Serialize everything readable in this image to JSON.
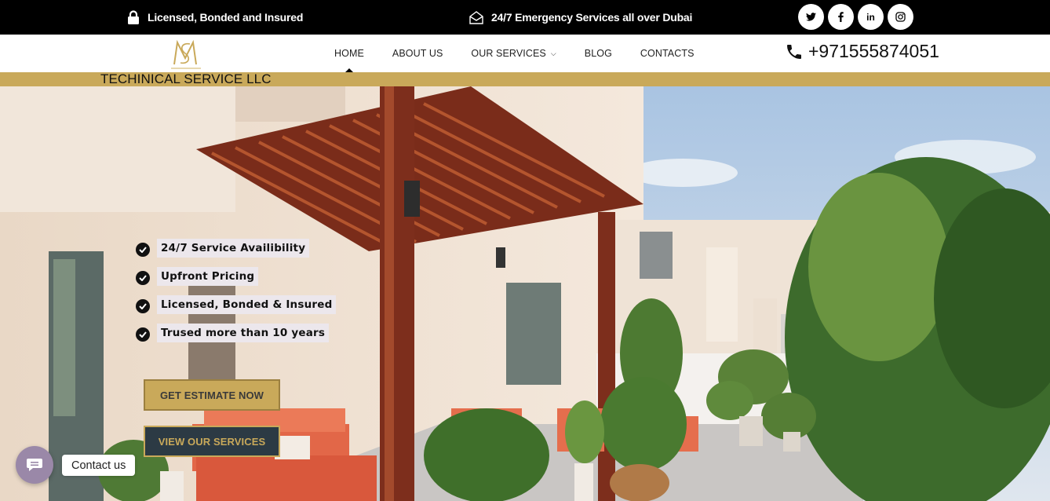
{
  "topbar": {
    "license_text": "Licensed, Bonded and Insured",
    "emergency_text": "24/7 Emergency Services all over Dubai",
    "socials": [
      {
        "icon": "twitter-icon",
        "glyph": "t"
      },
      {
        "icon": "facebook-icon",
        "glyph": "f"
      },
      {
        "icon": "linkedin-icon",
        "glyph": "in"
      },
      {
        "icon": "instagram-icon",
        "glyph": "◎"
      }
    ]
  },
  "nav": {
    "items": [
      {
        "label": "HOME",
        "active": true
      },
      {
        "label": "ABOUT US"
      },
      {
        "label": "OUR SERVICES",
        "dropdown": true
      },
      {
        "label": "BLOG"
      },
      {
        "label": "CONTACTS"
      }
    ],
    "phone": "+971555874051"
  },
  "brand": {
    "company_name": "TECHINICAL SERVICE LLC",
    "logo_text": "TECHINICAL SERVICE LLC",
    "gold": "#c9a95a"
  },
  "hero": {
    "features": [
      "24/7 Service Availibility",
      "Upfront Pricing",
      "Licensed, Bonded & Insured",
      "Trused more than 10 years"
    ],
    "estimate_button": "GET ESTIMATE NOW",
    "services_button": "VIEW OUR SERVICES"
  },
  "chat": {
    "label": "Contact us"
  }
}
